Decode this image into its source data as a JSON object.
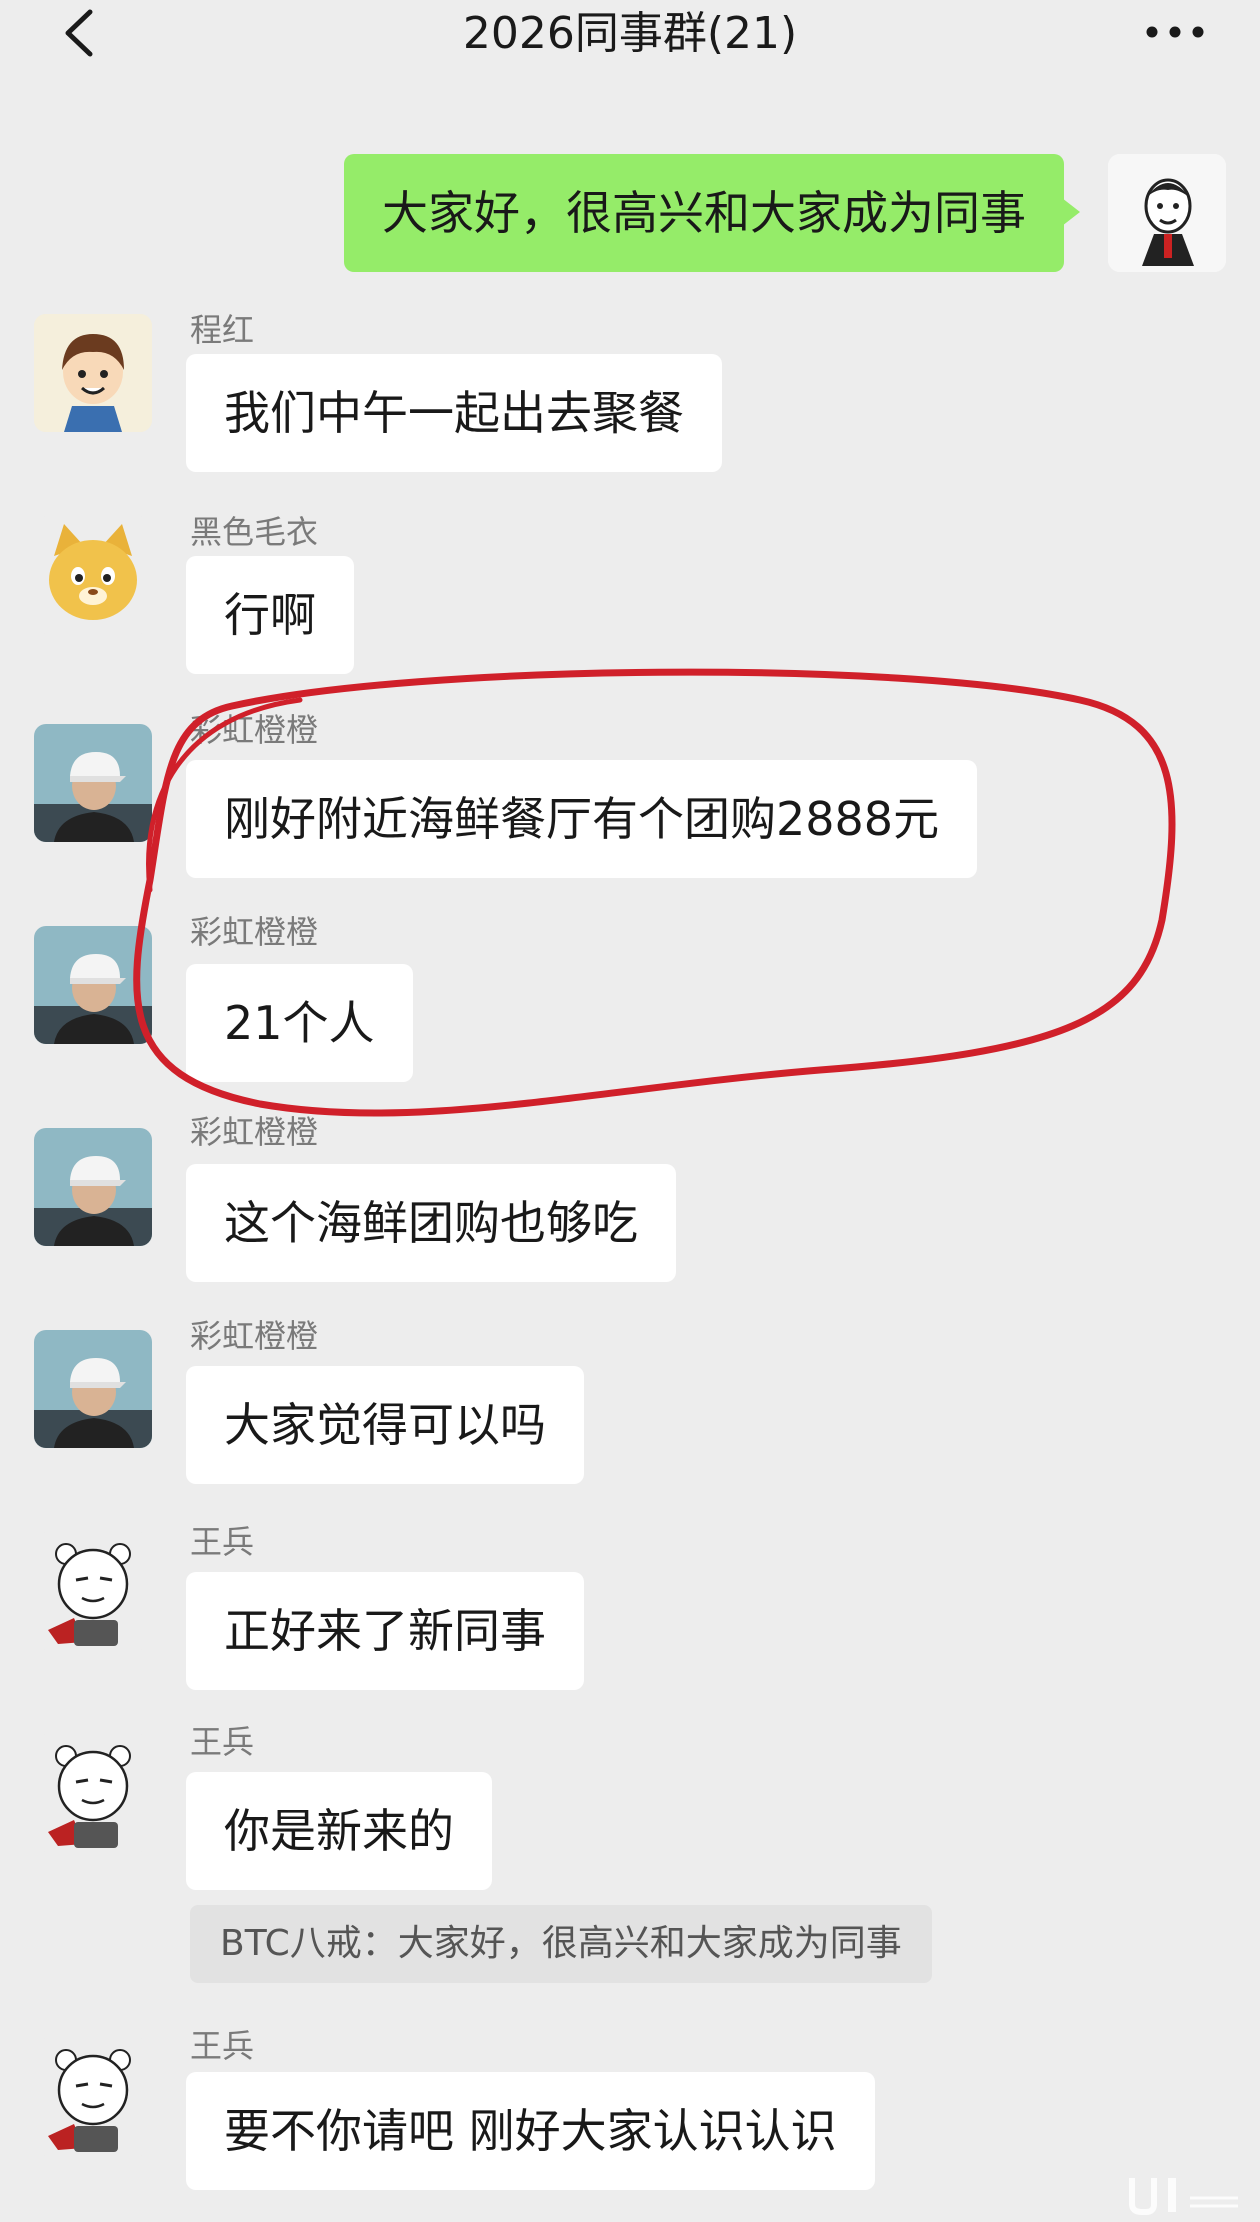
{
  "header": {
    "title": "2026同事群(21)",
    "back_icon": "chevron-left-icon",
    "more_icon": "more-dots-icon"
  },
  "self_message": {
    "text": "大家好，很高兴和大家成为同事"
  },
  "messages": [
    {
      "sender": "程红",
      "text": "我们中午一起出去聚餐"
    },
    {
      "sender": "黑色毛衣",
      "text": "行啊"
    },
    {
      "sender": "彩虹橙橙",
      "text": "刚好附近海鲜餐厅有个团购2888元"
    },
    {
      "sender": "彩虹橙橙",
      "text": "21个人"
    },
    {
      "sender": "彩虹橙橙",
      "text": "这个海鲜团购也够吃"
    },
    {
      "sender": "彩虹橙橙",
      "text": "大家觉得可以吗"
    },
    {
      "sender": "王兵",
      "text": "正好来了新同事"
    },
    {
      "sender": "王兵",
      "text": "你是新来的"
    },
    {
      "sender": "王兵",
      "text": "要不你请吧 刚好大家认识认识"
    }
  ],
  "system_note": {
    "text": "BTC八戒：大家好，很高兴和大家成为同事"
  },
  "colors": {
    "background": "#ededed",
    "self_bubble": "#95ec69",
    "other_bubble": "#ffffff",
    "annotation_circle": "#d0202a"
  }
}
